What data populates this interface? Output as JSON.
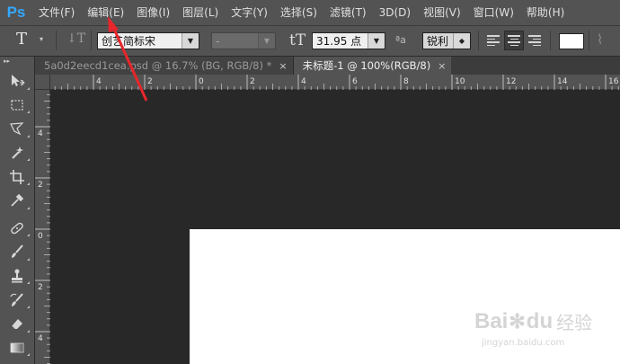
{
  "app": {
    "logo": "Ps"
  },
  "menu": [
    "文件(F)",
    "编辑(E)",
    "图像(I)",
    "图层(L)",
    "文字(Y)",
    "选择(S)",
    "滤镜(T)",
    "3D(D)",
    "视图(V)",
    "窗口(W)",
    "帮助(H)"
  ],
  "options": {
    "tool_glyph": "T",
    "orient_glyph": "↓T",
    "font_family": "创艺简标宋",
    "font_style": "-",
    "size_glyph": "tT",
    "font_size": "31.95 点",
    "aa_glyph": "ªa",
    "antialias": "锐利",
    "text_color": "#ffffff",
    "warp_glyph": "⌇"
  },
  "tabs": [
    {
      "title": "5a0d2eecd1cea.psd @ 16.7% (BG, RGB/8) *",
      "active": false,
      "close": "×"
    },
    {
      "title": "未标题-1 @ 100%(RGB/8)",
      "active": true,
      "close": "×"
    }
  ],
  "ruler": {
    "h_labels": [
      "4",
      "2",
      "0",
      "2",
      "4",
      "6",
      "8",
      "10",
      "12",
      "14",
      "16"
    ],
    "v_labels": [
      "4",
      "2",
      "0",
      "2",
      "4"
    ]
  },
  "tools": [
    "move-tool",
    "marquee-tool",
    "lasso-tool",
    "magic-wand-tool",
    "crop-tool",
    "eyedropper-tool",
    "healing-brush-tool",
    "brush-tool",
    "clone-stamp-tool",
    "history-brush-tool",
    "eraser-tool",
    "gradient-tool"
  ],
  "watermark": {
    "brand": "Bai",
    "brand2": "du",
    "cn": "经验",
    "url": "jingyan.baidu.com"
  },
  "colors": {
    "ps_blue": "#31a8ff",
    "annotation_red": "#e8262b",
    "canvas": "#282828",
    "panel": "#535353"
  }
}
